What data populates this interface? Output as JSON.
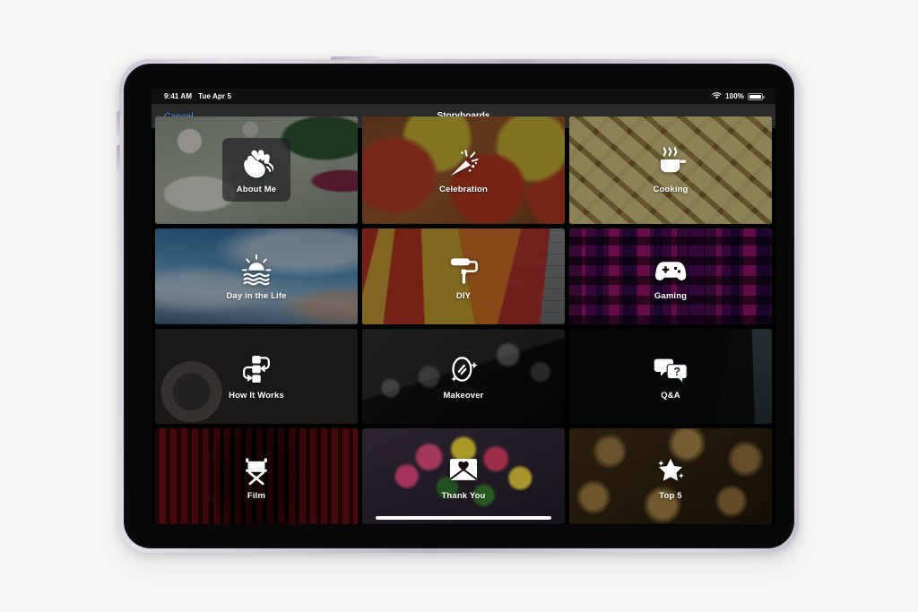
{
  "device": {
    "name": "iPad Air",
    "frame_color": "#c8c2d4"
  },
  "status_bar": {
    "time": "9:41 AM",
    "date": "Tue Apr 5",
    "wifi_icon": "wifi-icon",
    "battery_percent": "100%",
    "battery_icon": "battery-full-icon"
  },
  "nav": {
    "cancel_label": "Cancel",
    "title": "Storyboards"
  },
  "grid": {
    "tiles": [
      {
        "label": "About Me",
        "icon": "waving-hand-icon",
        "selected": true,
        "bg_class": "bg-aboutme",
        "bright": false
      },
      {
        "label": "Celebration",
        "icon": "party-popper-icon",
        "selected": false,
        "bg_class": "bg-celebration",
        "bright": false
      },
      {
        "label": "Cooking",
        "icon": "steaming-pot-icon",
        "selected": false,
        "bg_class": "bg-cooking",
        "bright": false
      },
      {
        "label": "Day in the Life",
        "icon": "sunrise-water-icon",
        "selected": false,
        "bg_class": "bg-dayinlife",
        "bright": false
      },
      {
        "label": "DIY",
        "icon": "paint-roller-icon",
        "selected": false,
        "bg_class": "bg-diy",
        "bright": false
      },
      {
        "label": "Gaming",
        "icon": "game-controller-icon",
        "selected": false,
        "bg_class": "bg-gaming",
        "bright": false
      },
      {
        "label": "How It Works",
        "icon": "process-flow-icon",
        "selected": false,
        "bg_class": "bg-howitworks",
        "bright": false
      },
      {
        "label": "Makeover",
        "icon": "mirror-sparkle-icon",
        "selected": false,
        "bg_class": "bg-makeover",
        "bright": false
      },
      {
        "label": "Q&A",
        "icon": "question-bubbles-icon",
        "selected": false,
        "bg_class": "bg-qa",
        "bright": false
      },
      {
        "label": "Film",
        "icon": "director-chair-icon",
        "selected": false,
        "bg_class": "bg-film",
        "bright": false
      },
      {
        "label": "Thank You",
        "icon": "heart-envelope-icon",
        "selected": false,
        "bg_class": "bg-thankyou",
        "bright": true
      },
      {
        "label": "Top 5",
        "icon": "star-sparkle-icon",
        "selected": false,
        "bg_class": "bg-top5",
        "bright": false
      }
    ]
  },
  "home_indicator": {
    "name": "home-indicator"
  },
  "colors": {
    "accent_blue": "#2f94f0",
    "navbar_bg": "#2a2a2c",
    "screen_bg": "#000000",
    "label_text": "#ffffff"
  }
}
